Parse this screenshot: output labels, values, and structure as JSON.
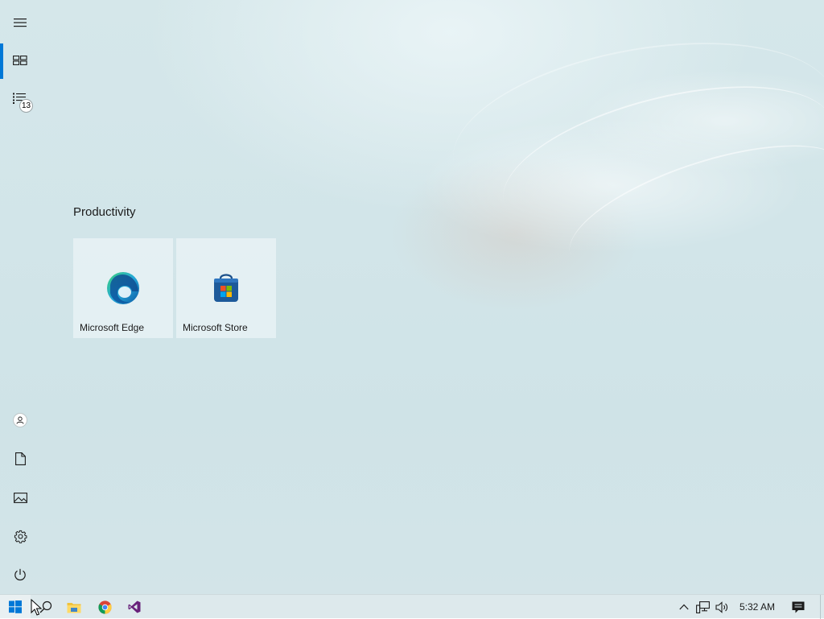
{
  "start_menu": {
    "rail": {
      "items": [
        {
          "name": "expand",
          "icon": "hamburger-icon"
        },
        {
          "name": "pinned-tiles",
          "icon": "tiles-icon",
          "active": true
        },
        {
          "name": "all-apps",
          "icon": "list-icon",
          "badge": "13"
        },
        {
          "name": "account",
          "icon": "user-icon"
        },
        {
          "name": "documents",
          "icon": "document-icon"
        },
        {
          "name": "pictures",
          "icon": "picture-icon"
        },
        {
          "name": "settings",
          "icon": "gear-icon"
        },
        {
          "name": "power",
          "icon": "power-icon"
        }
      ]
    },
    "group": {
      "title": "Productivity",
      "tiles": [
        {
          "label": "Microsoft Edge",
          "icon": "edge-icon"
        },
        {
          "label": "Microsoft Store",
          "icon": "store-icon"
        }
      ]
    }
  },
  "taskbar": {
    "pinned": [
      {
        "name": "start",
        "icon": "windows-logo-icon"
      },
      {
        "name": "search",
        "icon": "search-icon"
      },
      {
        "name": "file-explorer",
        "icon": "folder-icon"
      },
      {
        "name": "chrome",
        "icon": "chrome-icon"
      },
      {
        "name": "visual-studio",
        "icon": "visual-studio-icon"
      }
    ],
    "tray": {
      "icons": [
        "chevron-up-icon",
        "network-icon",
        "volume-icon"
      ],
      "clock": "5:32 AM",
      "notifications_icon": "action-center-icon"
    }
  },
  "colors": {
    "accent": "#0078d7",
    "desktop_background": "#d2e5e9",
    "taskbar": "#dde9ec"
  }
}
